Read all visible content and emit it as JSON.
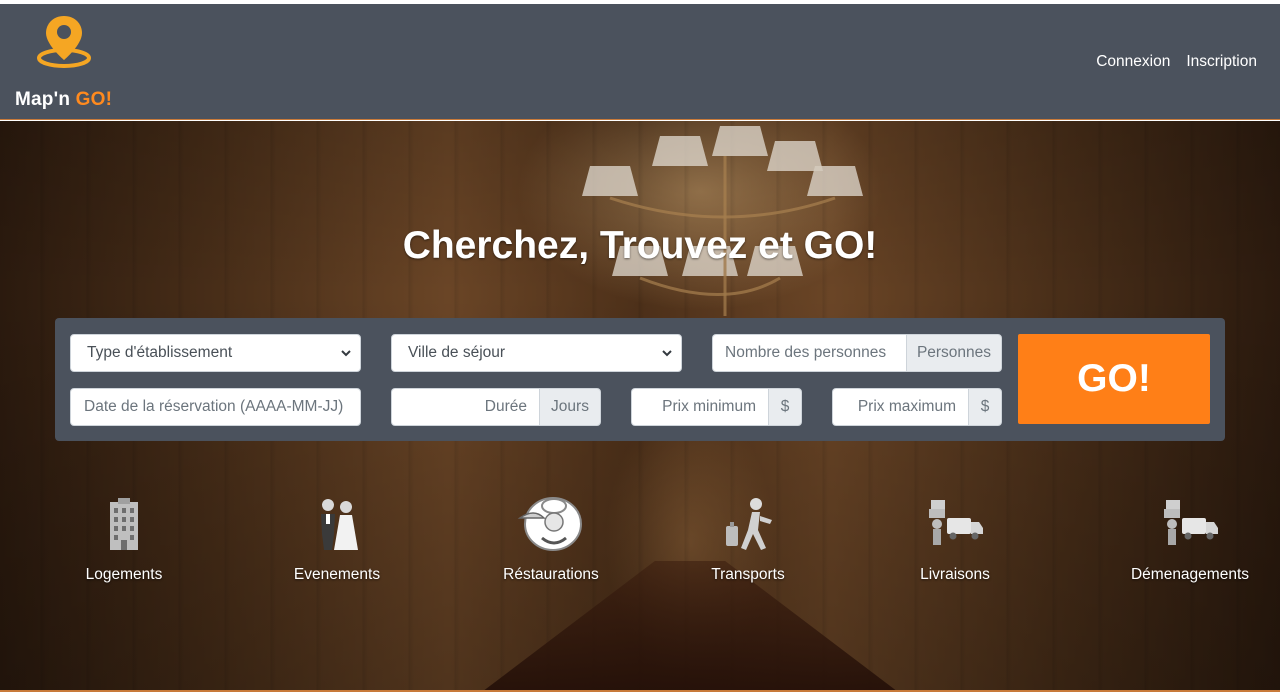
{
  "brand": {
    "name": "Map'n ",
    "accent": "GO!",
    "logo_icon": "map-pin-icon",
    "accent_color": "#ff8a1e"
  },
  "nav": {
    "login": "Connexion",
    "register": "Inscription"
  },
  "hero": {
    "headline": "Cherchez, Trouvez et GO!"
  },
  "search": {
    "type_select": "Type d'établissement",
    "city_select": "Ville de séjour",
    "persons_placeholder": "Nombre des personnes",
    "persons_addon": "Personnes",
    "date_placeholder": "Date de la réservation (AAAA-MM-JJ)",
    "duration_placeholder": "Durée",
    "duration_addon": "Jours",
    "min_price_placeholder": "Prix minimum",
    "min_price_addon": "$",
    "max_price_placeholder": "Prix maximum",
    "max_price_addon": "$",
    "go_label": "GO!",
    "go_color": "#ff7f17"
  },
  "categories": [
    {
      "label": "Logements",
      "icon": "building-icon"
    },
    {
      "label": "Evenements",
      "icon": "wedding-couple-icon"
    },
    {
      "label": "Réstaurations",
      "icon": "chef-icon"
    },
    {
      "label": "Transports",
      "icon": "traveler-icon"
    },
    {
      "label": "Livraisons",
      "icon": "delivery-truck-icon"
    },
    {
      "label": "Démenagements",
      "icon": "moving-truck-icon"
    }
  ]
}
